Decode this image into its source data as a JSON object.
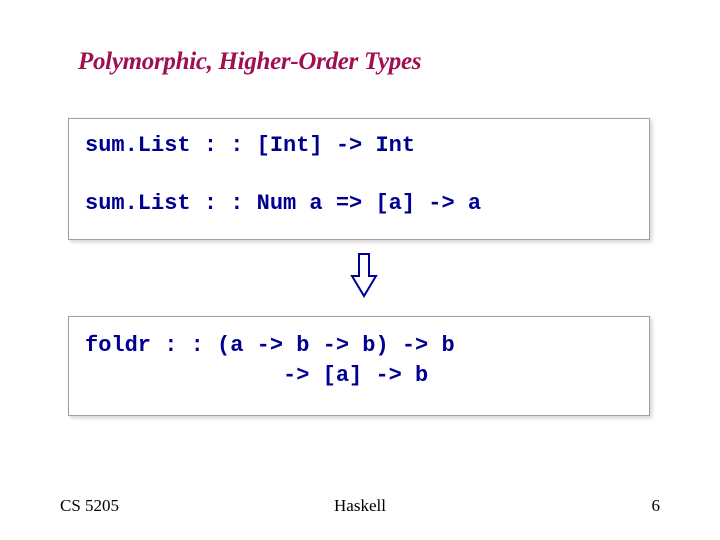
{
  "title": "Polymorphic, Higher-Order Types",
  "box1": {
    "line1": "sum.List : : [Int] -> Int",
    "line2": "sum.List : : Num a => [a] -> a"
  },
  "box2": {
    "line1": "foldr : : (a -> b -> b) -> b",
    "line2": "               -> [a] -> b"
  },
  "footer": {
    "left": "CS 5205",
    "center": "Haskell",
    "right": "6"
  }
}
